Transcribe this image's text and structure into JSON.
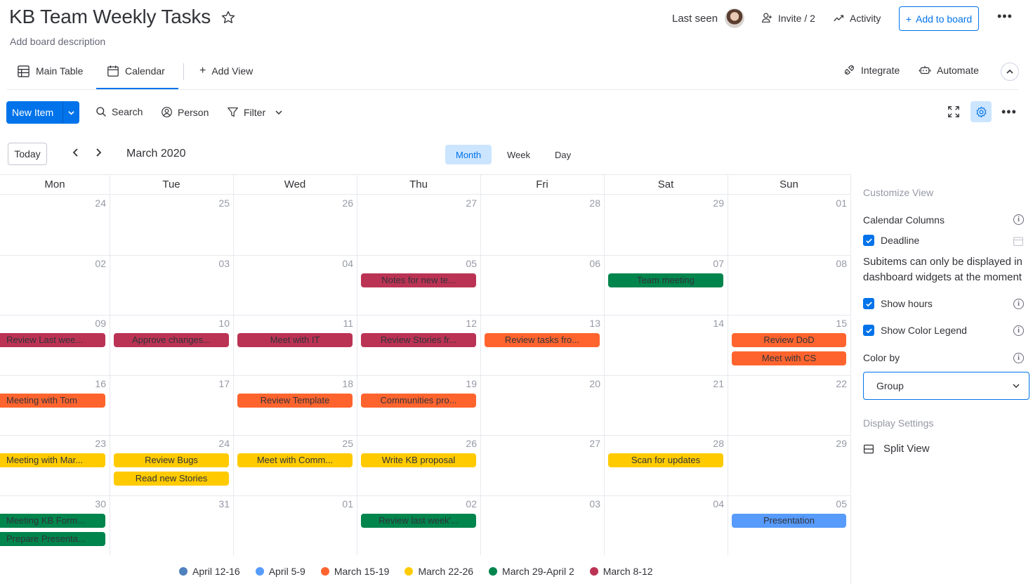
{
  "header": {
    "title": "KB Team Weekly Tasks",
    "description": "Add board description",
    "last_seen": "Last seen",
    "invite": "Invite / 2",
    "activity": "Activity",
    "add_to_board": "Add to board",
    "more": "•••"
  },
  "views": {
    "main_table": "Main Table",
    "calendar": "Calendar",
    "add_view": "Add View",
    "integrate": "Integrate",
    "automate": "Automate"
  },
  "toolbar": {
    "new_item": "New Item",
    "search": "Search",
    "person": "Person",
    "filter": "Filter",
    "more": "•••"
  },
  "calendar": {
    "today": "Today",
    "month_label": "March 2020",
    "modes": [
      "Month",
      "Week",
      "Day"
    ],
    "active_mode": "Month",
    "weekdays": [
      "Mon",
      "Tue",
      "Wed",
      "Thu",
      "Fri",
      "Sat",
      "Sun"
    ],
    "weeks": [
      [
        "24",
        "25",
        "26",
        "27",
        "28",
        "29",
        "01"
      ],
      [
        "02",
        "03",
        "04",
        "05",
        "06",
        "07",
        "08"
      ],
      [
        "09",
        "10",
        "11",
        "12",
        "13",
        "14",
        "15"
      ],
      [
        "16",
        "17",
        "18",
        "19",
        "20",
        "21",
        "22"
      ],
      [
        "23",
        "24",
        "25",
        "26",
        "27",
        "28",
        "29"
      ],
      [
        "30",
        "31",
        "01",
        "02",
        "03",
        "04",
        "05"
      ]
    ],
    "events": [
      {
        "week": 1,
        "day": 3,
        "slot": 0,
        "title": "Notes for new te...",
        "group": "March 8-12"
      },
      {
        "week": 1,
        "day": 5,
        "slot": 0,
        "title": "Team meeting",
        "group": "March 29-April 2"
      },
      {
        "week": 2,
        "day": 0,
        "slot": 0,
        "title": "Review Last wee...",
        "group": "March 8-12"
      },
      {
        "week": 2,
        "day": 1,
        "slot": 0,
        "title": "Approve changes...",
        "group": "March 8-12"
      },
      {
        "week": 2,
        "day": 2,
        "slot": 0,
        "title": "Meet with IT",
        "group": "March 8-12"
      },
      {
        "week": 2,
        "day": 3,
        "slot": 0,
        "title": "Review Stories fr...",
        "group": "March 8-12"
      },
      {
        "week": 2,
        "day": 4,
        "slot": 0,
        "title": "Review tasks fro...",
        "group": "March 15-19"
      },
      {
        "week": 2,
        "day": 6,
        "slot": 0,
        "title": "Review DoD",
        "group": "March 15-19"
      },
      {
        "week": 2,
        "day": 6,
        "slot": 1,
        "title": "Meet with CS",
        "group": "March 15-19"
      },
      {
        "week": 3,
        "day": 0,
        "slot": 0,
        "title": "Meeting with Tom",
        "group": "March 15-19"
      },
      {
        "week": 3,
        "day": 2,
        "slot": 0,
        "title": "Review Template",
        "group": "March 15-19"
      },
      {
        "week": 3,
        "day": 3,
        "slot": 0,
        "title": "Communities pro...",
        "group": "March 15-19"
      },
      {
        "week": 4,
        "day": 0,
        "slot": 0,
        "title": "Meeting with Mar...",
        "group": "March 22-26"
      },
      {
        "week": 4,
        "day": 1,
        "slot": 0,
        "title": "Review Bugs",
        "group": "March 22-26"
      },
      {
        "week": 4,
        "day": 1,
        "slot": 1,
        "title": "Read new Stories",
        "group": "March 22-26"
      },
      {
        "week": 4,
        "day": 2,
        "slot": 0,
        "title": "Meet with Comm...",
        "group": "March 22-26"
      },
      {
        "week": 4,
        "day": 3,
        "slot": 0,
        "title": "Write KB proposal",
        "group": "March 22-26"
      },
      {
        "week": 4,
        "day": 5,
        "slot": 0,
        "title": "Scan for updates",
        "group": "March 22-26"
      },
      {
        "week": 5,
        "day": 0,
        "slot": 0,
        "title": "Meeting KB Form...",
        "group": "March 29-April 2"
      },
      {
        "week": 5,
        "day": 0,
        "slot": 1,
        "title": "Prepare Presenta...",
        "group": "March 29-April 2"
      },
      {
        "week": 5,
        "day": 3,
        "slot": 0,
        "title": "Review last week'...",
        "group": "March 29-April 2"
      },
      {
        "week": 5,
        "day": 6,
        "slot": 0,
        "title": "Presentation",
        "group": "April 5-9"
      }
    ]
  },
  "groups": [
    {
      "name": "April 12-16",
      "color": "#4f81bd",
      "text": "#323338"
    },
    {
      "name": "April 5-9",
      "color": "#579bfc",
      "text": "#323338"
    },
    {
      "name": "March 15-19",
      "color": "#ff642e",
      "text": "#323338"
    },
    {
      "name": "March 22-26",
      "color": "#ffcb00",
      "text": "#323338"
    },
    {
      "name": "March 29-April 2",
      "color": "#00854d",
      "text": "#323338"
    },
    {
      "name": "March 8-12",
      "color": "#bb3354",
      "text": "#323338"
    }
  ],
  "panel": {
    "customize_view": "Customize View",
    "calendar_columns": "Calendar Columns",
    "deadline": "Deadline",
    "subitems_note": "Subitems can only be displayed in dashboard widgets at the moment",
    "show_hours": "Show hours",
    "show_color_legend": "Show Color Legend",
    "color_by": "Color by",
    "color_by_value": "Group",
    "display_settings": "Display Settings",
    "split_view": "Split View"
  }
}
